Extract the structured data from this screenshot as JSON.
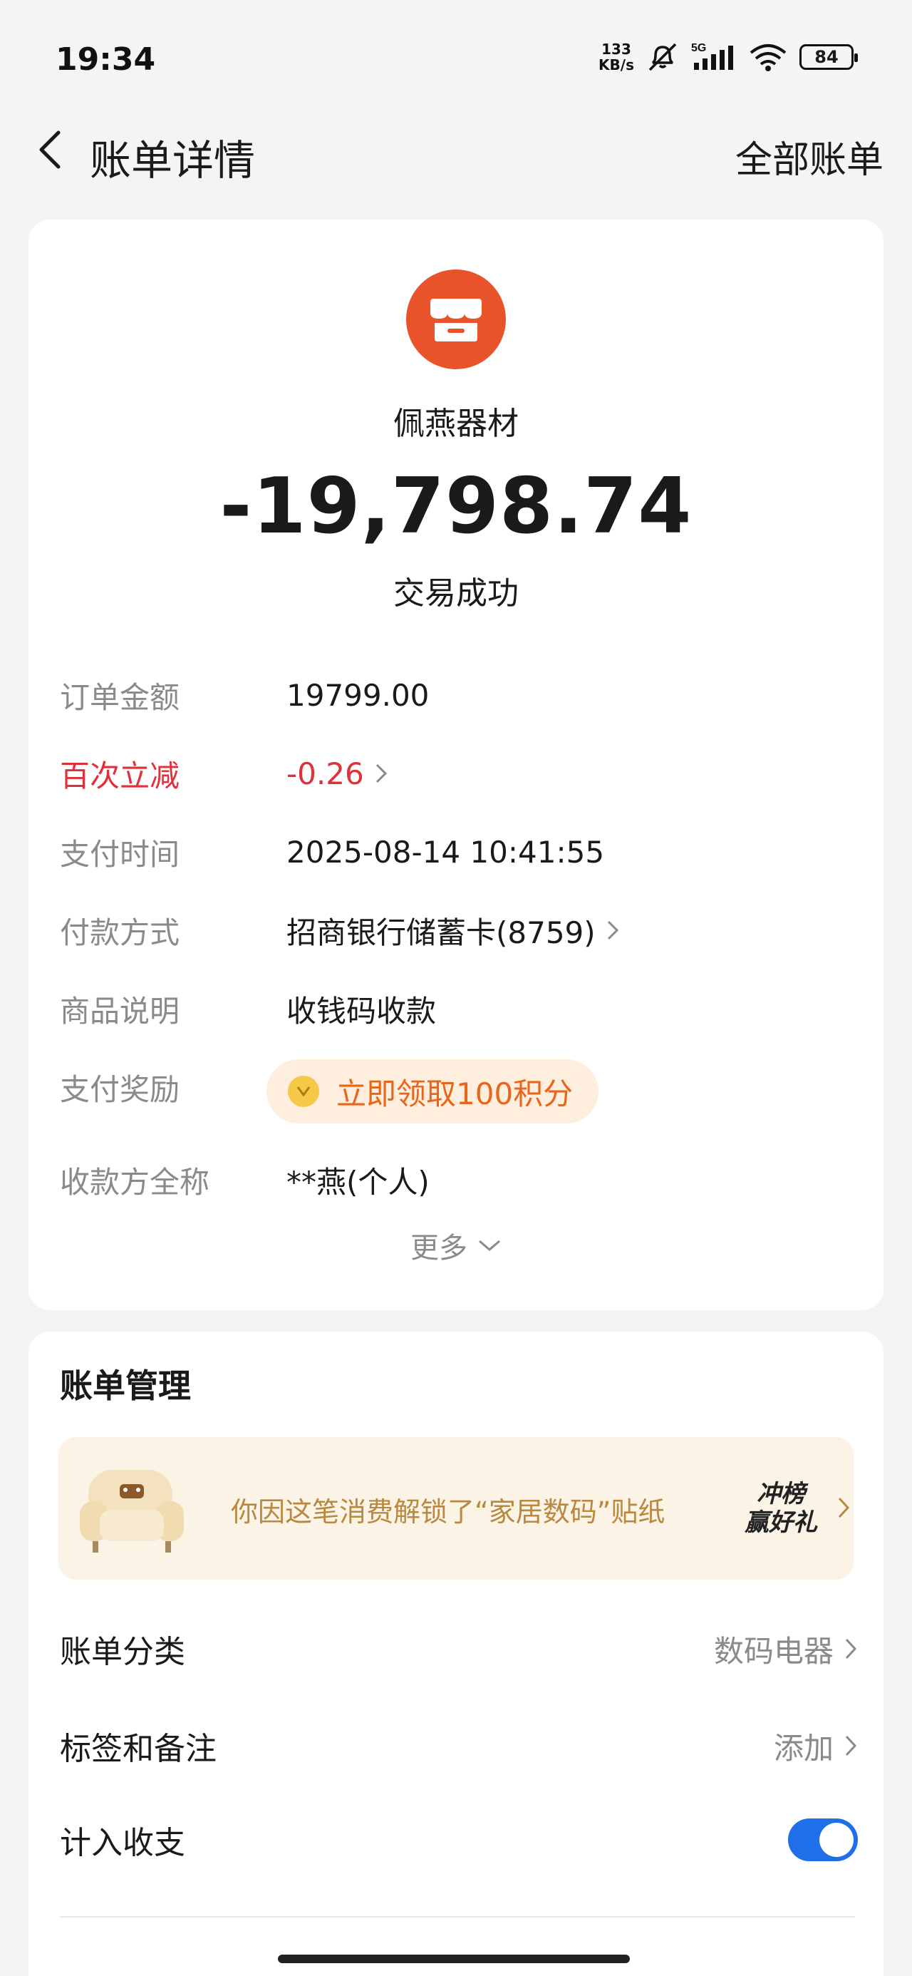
{
  "status_bar": {
    "time": "19:34",
    "net_speed_value": "133",
    "net_speed_unit": "KB/s",
    "signal_label": "5G",
    "battery": "84"
  },
  "header": {
    "title": "账单详情",
    "right_link": "全部账单"
  },
  "transaction": {
    "merchant": "佩燕器材",
    "amount": "-19,798.74",
    "status": "交易成功"
  },
  "details": {
    "order_amount_label": "订单金额",
    "order_amount": "19799.00",
    "discount_label": "百次立减",
    "discount": "-0.26",
    "pay_time_label": "支付时间",
    "pay_time": "2025-08-14 10:41:55",
    "pay_method_label": "付款方式",
    "pay_method": "招商银行储蓄卡(8759)",
    "goods_label": "商品说明",
    "goods": "收钱码收款",
    "reward_label": "支付奖励",
    "reward": "立即领取100积分",
    "payee_label": "收款方全称",
    "payee": "**燕(个人)",
    "more": "更多"
  },
  "manage": {
    "title": "账单管理",
    "banner_text": "你因这笔消费解锁了“家居数码”贴纸",
    "badge_line1": "冲榜",
    "badge_line2": "赢好礼",
    "category_label": "账单分类",
    "category_value": "数码电器",
    "tag_label": "标签和备注",
    "tag_value": "添加",
    "count_label": "计入收支",
    "count_enabled": true
  },
  "colors": {
    "accent_red": "#e0303a",
    "merchant_orange": "#e8532a",
    "toggle_blue": "#1f6fe8",
    "reward_orange": "#e8661c"
  },
  "icons": [
    "back-arrow-icon",
    "store-icon",
    "chevron-right-icon",
    "chevron-down-icon",
    "coin-icon",
    "sofa-icon",
    "wifi-icon",
    "signal-icon",
    "mute-icon",
    "battery-icon"
  ]
}
